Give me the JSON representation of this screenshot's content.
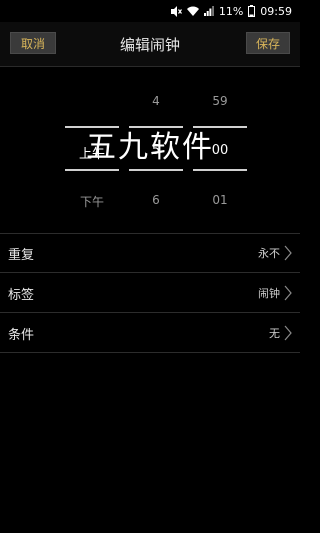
{
  "status_bar": {
    "battery_percent": "11%",
    "time": "09:59",
    "icons": [
      "mute-icon",
      "wifi-icon",
      "signal-icon",
      "battery-icon"
    ]
  },
  "header": {
    "cancel_label": "取消",
    "title": "编辑闹钟",
    "save_label": "保存"
  },
  "picker": {
    "ampm": {
      "above": "",
      "selected": "上午",
      "below": "下午"
    },
    "hour": {
      "above": "4",
      "selected": "5",
      "below": "6"
    },
    "minute": {
      "above": "59",
      "selected": "00",
      "below": "01"
    }
  },
  "watermark": "五九软件",
  "settings": [
    {
      "label": "重复",
      "value": "永不"
    },
    {
      "label": "标签",
      "value": "闹钟"
    },
    {
      "label": "条件",
      "value": "无"
    }
  ],
  "colors": {
    "accent": "#d7b45a",
    "background": "#000000",
    "button_bg": "#3a3a3a"
  }
}
